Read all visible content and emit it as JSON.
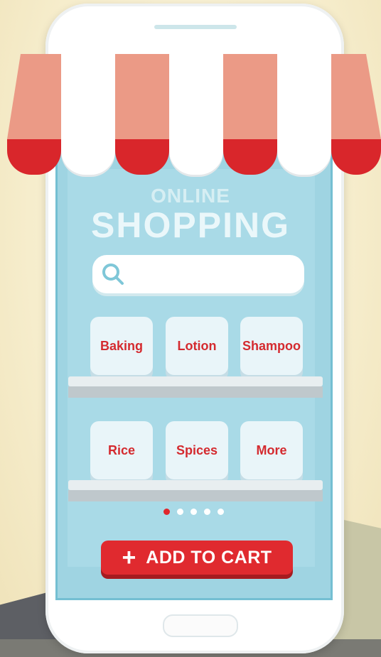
{
  "header": {
    "title_small": "ONLINE",
    "title_big": "SHOPPING"
  },
  "search": {
    "placeholder": "",
    "value": "",
    "icon": "search-icon"
  },
  "shelves": {
    "row1": [
      {
        "label": "Baking"
      },
      {
        "label": "Lotion"
      },
      {
        "label": "Shampoo"
      }
    ],
    "row2": [
      {
        "label": "Rice"
      },
      {
        "label": "Spices"
      },
      {
        "label": "More"
      }
    ]
  },
  "pagination": {
    "total": 5,
    "active": 1
  },
  "cart_button": {
    "label": "ADD TO CART",
    "icon": "plus-icon"
  },
  "colors": {
    "accent_red": "#e02a2f",
    "screen_blue": "#9fd4e2",
    "awning_stripe": "#eb9a86"
  }
}
